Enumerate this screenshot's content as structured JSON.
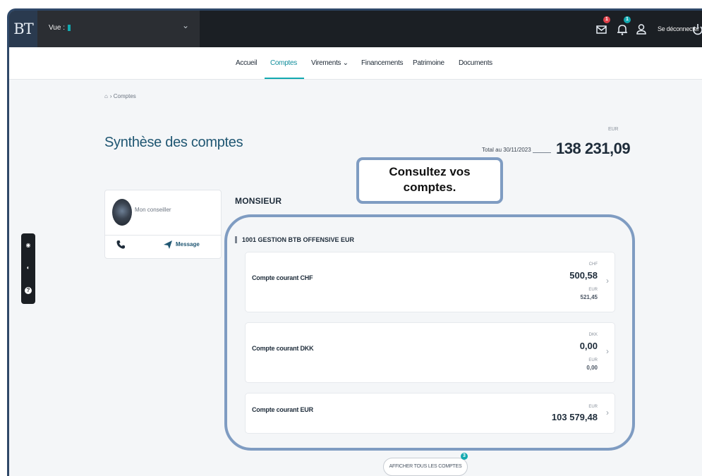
{
  "topbar": {
    "brand": "BT",
    "view_label": "Vue :",
    "logout_label": "Se déconnecter",
    "mail_badge": "1",
    "bell_badge": "1"
  },
  "nav": {
    "items": [
      "Accueil",
      "Comptes",
      "Virements",
      "Financements",
      "Patrimoine",
      "Documents"
    ],
    "active": "Comptes"
  },
  "breadcrumb": {
    "current": "Comptes"
  },
  "page": {
    "title": "Synthèse des comptes",
    "currency": "EUR",
    "total_date_label": "Total au 30/11/2023",
    "total_value": "138 231,09"
  },
  "callout": {
    "line1": "Consultez vos",
    "line2": "comptes."
  },
  "advisor": {
    "label": "Mon conseiller",
    "message_label": "Message"
  },
  "client": {
    "name": "MONSIEUR"
  },
  "group": {
    "name": "1001 GESTION BTB OFFENSIVE EUR"
  },
  "accounts": [
    {
      "name": "Compte courant CHF",
      "currency": "CHF",
      "amount": "500,58",
      "eur_label": "EUR",
      "eur_amount": "521,45"
    },
    {
      "name": "Compte courant DKK",
      "currency": "DKK",
      "amount": "0,00",
      "eur_label": "EUR",
      "eur_amount": "0,00"
    },
    {
      "name": "Compte courant EUR",
      "currency": "EUR",
      "amount": "103 579,48"
    }
  ],
  "show_all": {
    "label": "AFFICHER TOUS LES COMPTES",
    "badge": "3"
  },
  "colors": {
    "accent": "#12a9b0",
    "topbar": "#1b1f24",
    "title": "#1f5672",
    "highlight": "#7f9cc2"
  }
}
